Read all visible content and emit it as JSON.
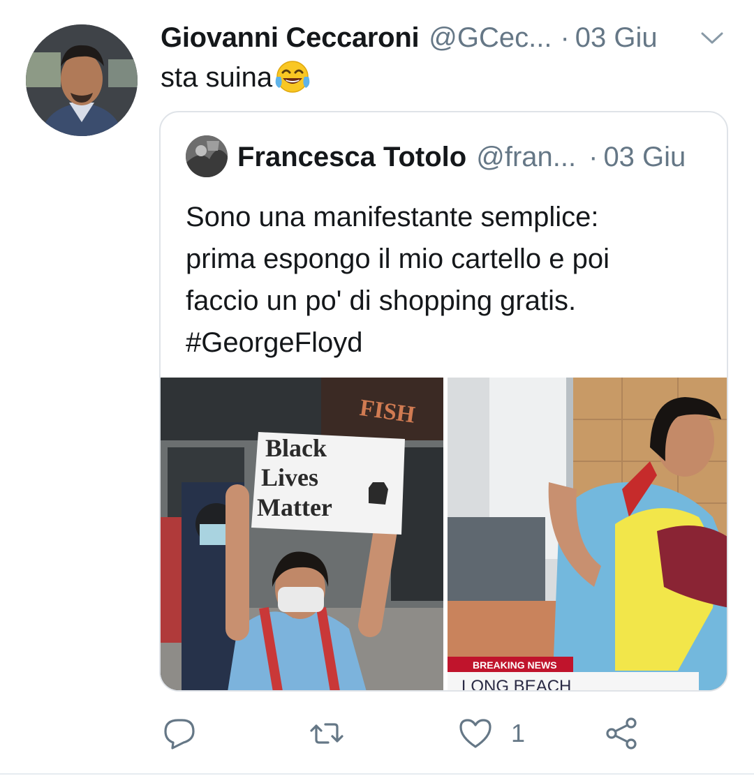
{
  "tweet": {
    "author_name": "Giovanni Ceccaroni",
    "author_handle": "@GCec...",
    "separator": "·",
    "date": "03 Giu",
    "text": "sta suina",
    "emoji": "face-with-tears-of-joy"
  },
  "quoted_tweet": {
    "author_name": "Francesca Totolo",
    "author_handle": "@fran...",
    "separator": "·",
    "date": "03 Giu",
    "text_lines": [
      "Sono una manifestante semplice:",
      "prima espongo il mio cartello e poi",
      "faccio un po' di shopping gratis.",
      "#GeorgeFloyd"
    ],
    "media": {
      "left": {
        "storefront_sign": "FISH",
        "placard_lines": [
          "Black",
          "Lives",
          "Matter"
        ]
      },
      "right": {
        "banner_label": "BREAKING NEWS",
        "banner_location": "LONG BEACH"
      }
    }
  },
  "actions": {
    "reply_icon": "reply-icon",
    "retweet_icon": "retweet-icon",
    "like_icon": "heart-icon",
    "like_count": "1",
    "share_icon": "share-icon"
  },
  "colors": {
    "text": "#14171a",
    "secondary": "#657786",
    "border": "#dfe3e8"
  }
}
